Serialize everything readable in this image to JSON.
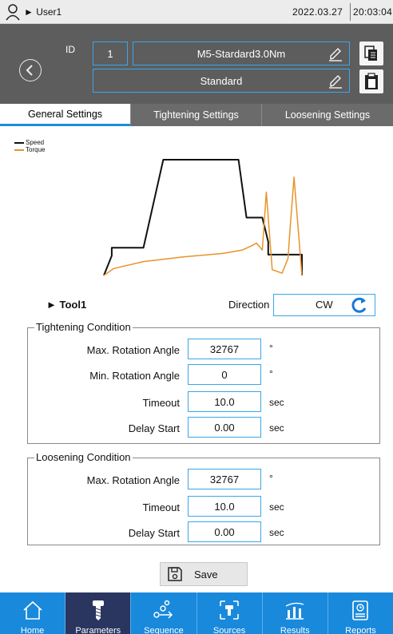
{
  "status": {
    "user": "User1",
    "date": "2022.03.27",
    "time": "20:03:04"
  },
  "header": {
    "id_label": "ID",
    "id_value": "1",
    "preset_name": "M5-Stardard3.0Nm",
    "mode": "Standard"
  },
  "tabs": [
    {
      "label": "General Settings",
      "active": true
    },
    {
      "label": "Tightening Settings",
      "active": false
    },
    {
      "label": "Loosening Settings",
      "active": false
    }
  ],
  "chart_data": {
    "type": "line",
    "legend": [
      "Speed",
      "Torque"
    ],
    "colors": {
      "Speed": "#111111",
      "Torque": "#e8932a"
    },
    "series": [
      {
        "name": "Speed",
        "x": [
          0,
          0.04,
          0.04,
          0.2,
          0.3,
          0.3,
          0.68,
          0.72,
          0.72,
          0.8,
          0.83,
          0.83,
          0.92,
          1.0,
          1.0
        ],
        "y": [
          0,
          0.17,
          0.24,
          0.24,
          1.0,
          1.0,
          1.0,
          0.5,
          0.5,
          0.5,
          0.29,
          0.18,
          0.18,
          0.18,
          0.0
        ]
      },
      {
        "name": "Torque",
        "x": [
          0.0,
          0.05,
          0.2,
          0.4,
          0.6,
          0.7,
          0.75,
          0.77,
          0.8,
          0.82,
          0.85,
          0.9,
          0.93,
          0.94,
          0.96,
          1.0
        ],
        "y": [
          0.0,
          0.06,
          0.12,
          0.16,
          0.19,
          0.22,
          0.26,
          0.28,
          0.22,
          0.72,
          0.05,
          0.02,
          0.15,
          0.4,
          0.85,
          0.0
        ]
      }
    ]
  },
  "tool": {
    "name": "Tool1",
    "direction_label": "Direction",
    "direction_value": "CW"
  },
  "tightening": {
    "title": "Tightening Condition",
    "rows": [
      {
        "label": "Max. Rotation Angle",
        "value": "32767",
        "unit": "°"
      },
      {
        "label": "Min. Rotation Angle",
        "value": "0",
        "unit": "°"
      },
      {
        "label": "Timeout",
        "value": "10.0",
        "unit": "sec"
      },
      {
        "label": "Delay Start",
        "value": "0.00",
        "unit": "sec"
      }
    ]
  },
  "loosening": {
    "title": "Loosening Condition",
    "rows": [
      {
        "label": "Max. Rotation Angle",
        "value": "32767",
        "unit": "°"
      },
      {
        "label": "Timeout",
        "value": "10.0",
        "unit": "sec"
      },
      {
        "label": "Delay Start",
        "value": "0.00",
        "unit": "sec"
      }
    ]
  },
  "save_label": "Save",
  "nav": [
    {
      "label": "Home",
      "icon": "home-icon",
      "active": false
    },
    {
      "label": "Parameters",
      "icon": "screw-icon",
      "active": true
    },
    {
      "label": "Sequence",
      "icon": "sequence-icon",
      "active": false
    },
    {
      "label": "Sources",
      "icon": "sources-icon",
      "active": false
    },
    {
      "label": "Results",
      "icon": "results-icon",
      "active": false
    },
    {
      "label": "Reports",
      "icon": "reports-icon",
      "active": false
    }
  ],
  "accent": "#1989dc"
}
